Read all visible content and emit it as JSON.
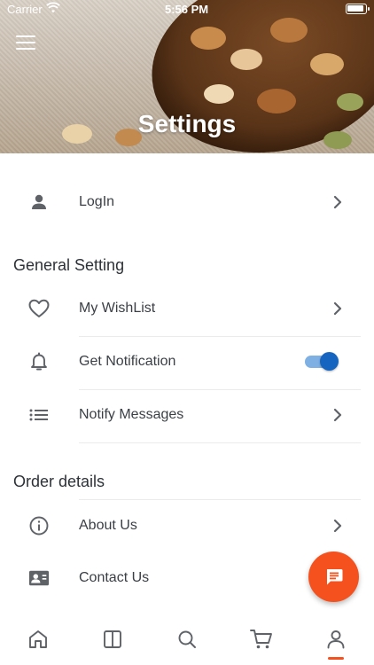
{
  "status_bar": {
    "carrier": "Carrier",
    "time": "5:56 PM"
  },
  "header": {
    "title": "Settings"
  },
  "login": {
    "label": "LogIn"
  },
  "general": {
    "title": "General Setting",
    "items": [
      {
        "label": "My WishList",
        "icon": "heart-icon"
      },
      {
        "label": "Get Notification",
        "icon": "bell-icon",
        "toggle_on": true
      },
      {
        "label": "Notify Messages",
        "icon": "list-icon"
      }
    ]
  },
  "order": {
    "title": "Order details",
    "items": [
      {
        "label": "About Us",
        "icon": "info-icon"
      },
      {
        "label": "Contact Us",
        "icon": "contact-card-icon"
      }
    ]
  },
  "tabs": [
    "home-icon",
    "catalog-icon",
    "search-icon",
    "cart-icon",
    "profile-icon"
  ],
  "colors": {
    "accent": "#f4511e",
    "toggle": "#1565c0",
    "text": "#3a3f45",
    "icon": "#5f6368"
  }
}
